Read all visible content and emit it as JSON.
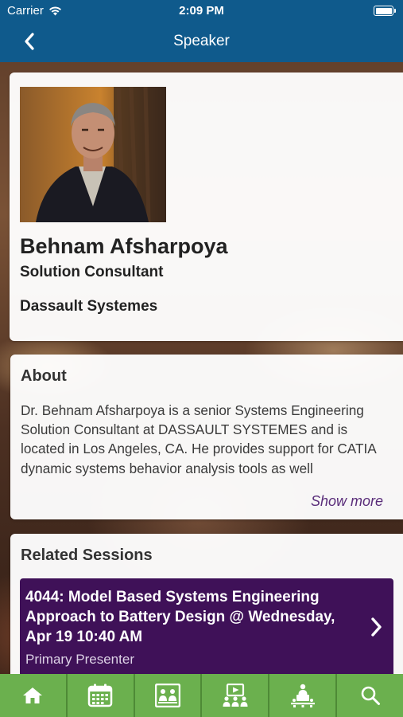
{
  "status_bar": {
    "carrier": "Carrier",
    "time": "2:09 PM"
  },
  "nav": {
    "title": "Speaker"
  },
  "speaker": {
    "name": "Behnam Afsharpoya",
    "role": "Solution Consultant",
    "company": "Dassault Systemes"
  },
  "about": {
    "title": "About",
    "text": "Dr. Behnam Afsharpoya is a senior Systems Engineering Solution Consultant at DASSAULT SYSTEMES and is located in Los Angeles, CA.  He provides support for CATIA dynamic systems behavior analysis tools as well",
    "show_more": "Show more"
  },
  "related_sessions": {
    "title": "Related Sessions",
    "items": [
      {
        "title": "4044: Model Based Systems Engineering Approach to Battery Design @ Wednesday, Apr 19 10:40 AM",
        "subtitle": "Primary Presenter"
      }
    ]
  },
  "tab_bar": [
    "home-icon",
    "calendar-icon",
    "attendees-icon",
    "presentations-icon",
    "speakers-icon",
    "search-icon"
  ],
  "colors": {
    "header": "#0f5a8c",
    "tab_bar": "#6bb04e",
    "session": "#3f1158",
    "show_more": "#5a2d7a"
  }
}
